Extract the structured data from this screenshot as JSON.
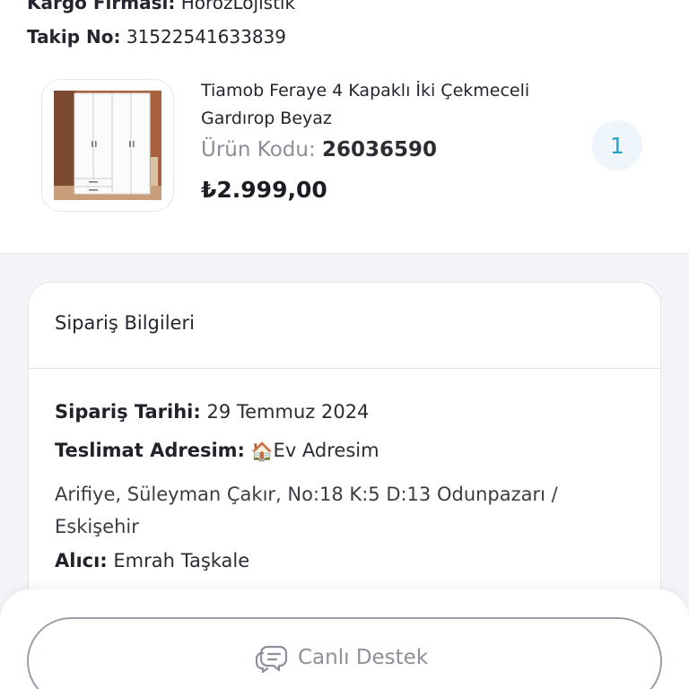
{
  "shipment": {
    "cargo_label": "Kargo Firması:",
    "cargo_value": "HorozLojistik",
    "tracking_label": "Takip No:",
    "tracking_value": "31522541633839"
  },
  "product": {
    "title": "Tiamob Feraye 4 Kapaklı İki Çekmeceli Gardırop Beyaz",
    "code_label": "Ürün Kodu:",
    "code_value": "26036590",
    "price": "₺2.999,00",
    "quantity": "1",
    "image_icon": "wardrobe-image"
  },
  "order_info": {
    "title": "Sipariş Bilgileri",
    "date_label": "Sipariş Tarihi:",
    "date_value": "29 Temmuz 2024",
    "address_label": "Teslimat Adresim:",
    "address_icon": "🏠",
    "address_name": "Ev Adresim",
    "address_text": "Arifiye, Süleyman Çakır, No:18 K:5 D:13 Odunpazarı / Eskişehir",
    "recipient_label": "Alıcı:",
    "recipient_value": "Emrah Taşkale"
  },
  "support": {
    "label": "Canlı Destek",
    "icon": "chat-bubbles-icon"
  },
  "colors": {
    "accent": "#1fa3c6",
    "quantity_bg": "#eef6fb",
    "page_bg": "#f3f5f8"
  }
}
